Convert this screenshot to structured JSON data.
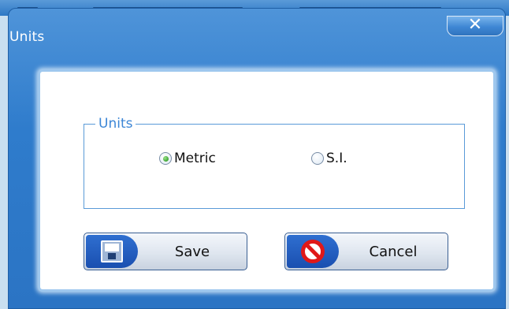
{
  "window": {
    "title": "Units",
    "close_glyph": "✕"
  },
  "units_group": {
    "legend": "Units",
    "options": [
      {
        "label": "Metric",
        "selected": true
      },
      {
        "label": "S.I.",
        "selected": false
      }
    ]
  },
  "buttons": {
    "save": {
      "label": "Save",
      "icon": "floppy-disk-icon"
    },
    "cancel": {
      "label": "Cancel",
      "icon": "prohibited-icon"
    }
  },
  "colors": {
    "title_bar": "#2f7ccc",
    "legend_text": "#3c86d6",
    "radio_selected": "#2f9a27",
    "cancel_icon": "#e01818"
  }
}
